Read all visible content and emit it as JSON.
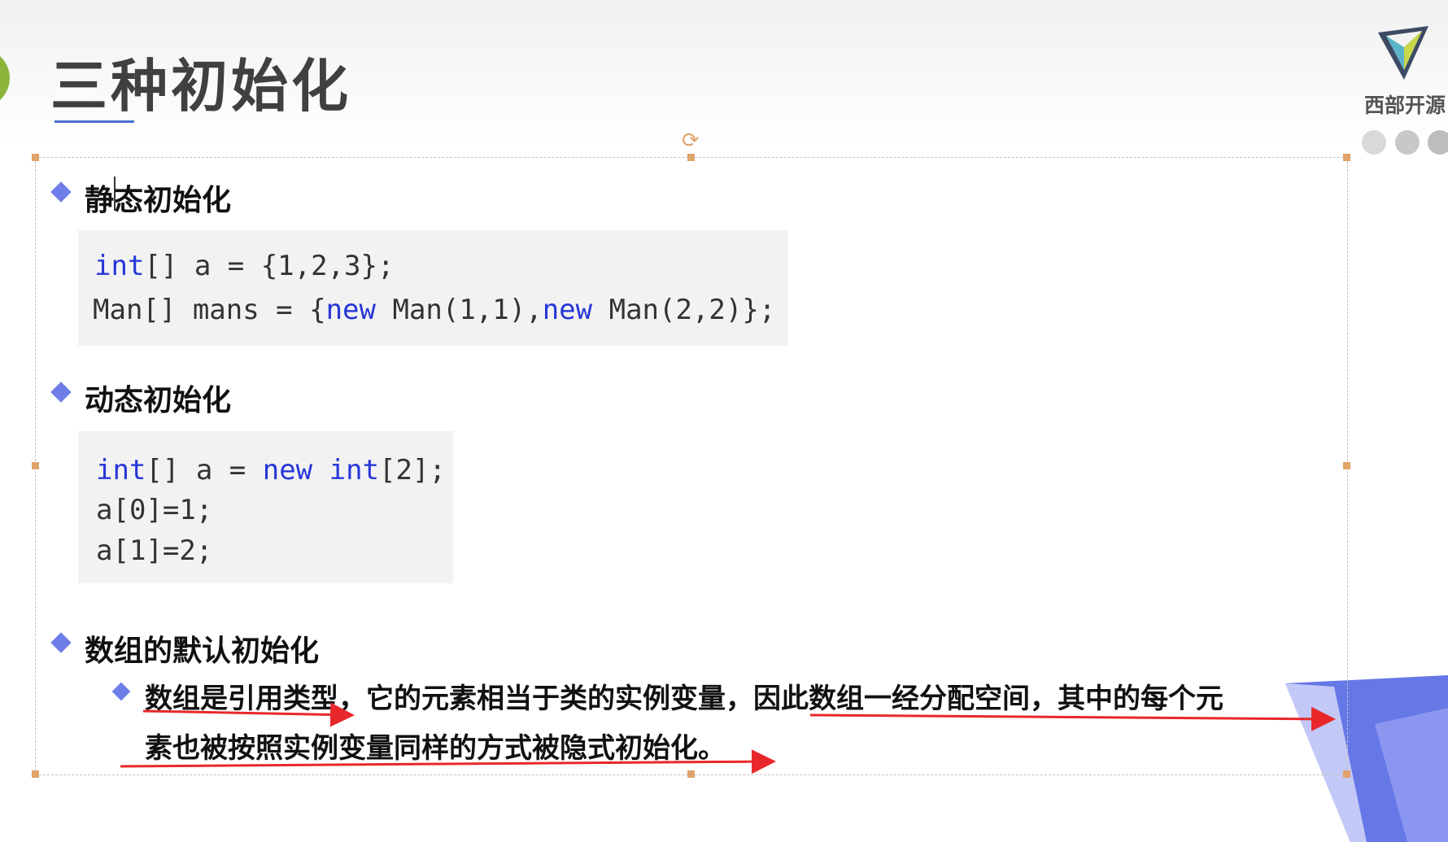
{
  "slide": {
    "title": "三种初始化",
    "logo_text": "西部开源",
    "colors": {
      "accent_blue": "#6e7ee8",
      "keyword": "#2636d8",
      "annotation_red": "#e8282a",
      "code_bg": "#f2f2f2"
    }
  },
  "sections": {
    "static": {
      "heading": "静态初始化",
      "code": [
        [
          {
            "t": "int",
            "kw": true
          },
          {
            "t": "[] a = {1,2,3};",
            "kw": false
          }
        ],
        [
          {
            "t": "Man[] mans = {",
            "kw": false
          },
          {
            "t": "new",
            "kw": true
          },
          {
            "t": " Man(1,1),",
            "kw": false
          },
          {
            "t": "new",
            "kw": true
          },
          {
            "t": " Man(2,2)};",
            "kw": false
          }
        ]
      ]
    },
    "dynamic": {
      "heading": "动态初始化",
      "code": [
        [
          {
            "t": "int",
            "kw": true
          },
          {
            "t": "[] a = ",
            "kw": false
          },
          {
            "t": "new",
            "kw": true
          },
          {
            "t": " ",
            "kw": false
          },
          {
            "t": "int",
            "kw": true
          },
          {
            "t": "[2];",
            "kw": false
          }
        ],
        [
          {
            "t": "a[0]=1;",
            "kw": false
          }
        ],
        [
          {
            "t": "a[1]=2;",
            "kw": false
          }
        ]
      ]
    },
    "default": {
      "heading": "数组的默认初始化",
      "paragraph_line1": "数组是引用类型，它的元素相当于类的实例变量，因此数组一经分配空间，其中的每个元",
      "paragraph_line2": "素也被按照实例变量同样的方式被隐式初始化。"
    }
  }
}
